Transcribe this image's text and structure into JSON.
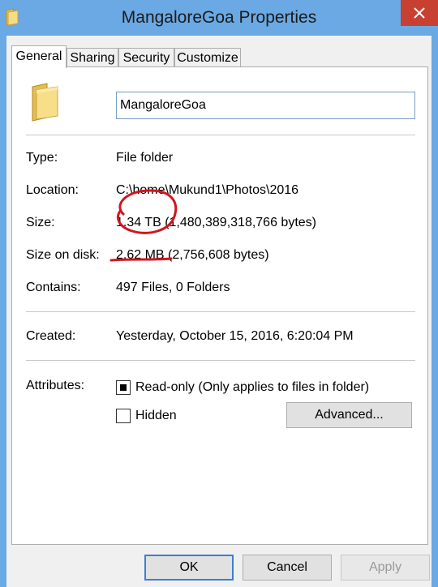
{
  "window": {
    "title": "MangaloreGoa Properties",
    "colors": {
      "titlebar": "#6aa9e3",
      "close": "#c84031",
      "annotation": "#d0151f"
    }
  },
  "tabs": [
    {
      "label": "General",
      "active": true
    },
    {
      "label": "Sharing"
    },
    {
      "label": "Security"
    },
    {
      "label": "Customize"
    }
  ],
  "general": {
    "icon": "folder-icon",
    "name_value": "MangaloreGoa",
    "rows": {
      "type": {
        "label": "Type:",
        "value": "File folder"
      },
      "location": {
        "label": "Location:",
        "value": "C:\\home\\Mukund1\\Photos\\2016"
      },
      "size": {
        "label": "Size:",
        "value": "1.34 TB (1,480,389,318,766 bytes)"
      },
      "disk": {
        "label": "Size on disk:",
        "value": "2.62 MB (2,756,608 bytes)"
      },
      "contains": {
        "label": "Contains:",
        "value": "497 Files, 0 Folders"
      },
      "created": {
        "label": "Created:",
        "value": "Yesterday, October 15, 2016, 6:20:04 PM"
      }
    },
    "attributes": {
      "label": "Attributes:",
      "readonly": {
        "label": "Read-only (Only applies to files in folder)",
        "checked": true
      },
      "hidden": {
        "label": "Hidden",
        "checked": false
      },
      "advanced_label": "Advanced..."
    }
  },
  "buttons": {
    "ok": "OK",
    "cancel": "Cancel",
    "apply": "Apply"
  }
}
